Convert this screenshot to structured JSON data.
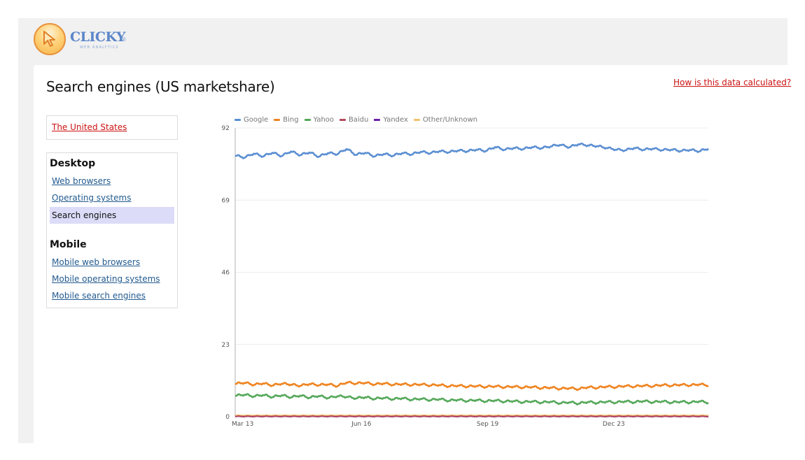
{
  "brand": {
    "name": "CLICKY",
    "registered_mark": "®",
    "tagline": "WEB ANALYTICS",
    "logo_icon": "cursor-arrow-icon"
  },
  "page": {
    "title": "Search engines (US marketshare)",
    "help_link": "How is this data calculated?"
  },
  "sidebar": {
    "country_link": "The United States",
    "sections": [
      {
        "heading": "Desktop",
        "items": [
          {
            "label": "Web browsers",
            "active": false
          },
          {
            "label": "Operating systems",
            "active": false
          },
          {
            "label": "Search engines",
            "active": true
          }
        ]
      },
      {
        "heading": "Mobile",
        "items": [
          {
            "label": "Mobile web browsers",
            "active": false
          },
          {
            "label": "Mobile operating systems",
            "active": false
          },
          {
            "label": "Mobile search engines",
            "active": false
          }
        ]
      }
    ]
  },
  "chart_data": {
    "type": "line",
    "title": "",
    "xlabel": "",
    "ylabel": "",
    "ylim": [
      0,
      92
    ],
    "yticks": [
      0,
      23,
      46,
      69,
      92
    ],
    "xtick_labels": [
      {
        "label": "Mar 13",
        "index": 0
      },
      {
        "label": "Jun 16",
        "index": 13.6
      },
      {
        "label": "Sep 19",
        "index": 27.2
      },
      {
        "label": "Dec 23",
        "index": 40.8
      }
    ],
    "grid": true,
    "legend_position": "top-left",
    "series": [
      {
        "name": "Google",
        "color": "#5b8fd2",
        "values": [
          83.2,
          82.5,
          83.8,
          82.9,
          84.1,
          83.0,
          84.5,
          83.3,
          84.2,
          82.8,
          84.0,
          83.6,
          85.3,
          83.4,
          84.1,
          82.9,
          83.7,
          83.1,
          84.0,
          83.5,
          84.4,
          83.9,
          84.6,
          84.2,
          84.8,
          84.5,
          85.1,
          84.6,
          85.9,
          85.0,
          85.6,
          85.2,
          85.9,
          85.5,
          86.1,
          86.6,
          85.8,
          86.8,
          86.4,
          86.2,
          85.6,
          85.1,
          84.8,
          85.6,
          85.0,
          85.4,
          84.9,
          85.1,
          84.6,
          85.0,
          84.5,
          85.4
        ]
      },
      {
        "name": "Bing",
        "color": "#ef8420",
        "values": [
          10.4,
          10.8,
          10.1,
          10.6,
          9.9,
          10.5,
          10.2,
          9.8,
          10.4,
          10.0,
          10.3,
          9.7,
          10.9,
          10.5,
          10.8,
          10.2,
          10.6,
          10.1,
          10.4,
          10.0,
          10.3,
          9.9,
          10.1,
          9.6,
          9.9,
          9.5,
          9.8,
          9.4,
          9.7,
          9.3,
          9.6,
          9.2,
          9.5,
          9.0,
          9.3,
          8.8,
          9.1,
          8.7,
          9.4,
          9.1,
          9.6,
          9.3,
          9.8,
          9.5,
          9.9,
          9.6,
          10.1,
          9.8,
          10.2,
          9.9,
          10.3,
          9.9
        ]
      },
      {
        "name": "Yahoo",
        "color": "#55a85a",
        "values": [
          6.6,
          7.0,
          6.4,
          6.9,
          6.2,
          6.8,
          6.1,
          6.7,
          6.0,
          6.6,
          5.9,
          6.5,
          6.3,
          5.8,
          6.2,
          5.6,
          6.0,
          5.5,
          5.9,
          5.3,
          5.7,
          5.2,
          5.6,
          5.0,
          5.4,
          4.9,
          5.3,
          4.8,
          5.2,
          4.7,
          5.0,
          4.5,
          4.9,
          4.4,
          4.8,
          4.2,
          4.6,
          4.1,
          4.7,
          4.3,
          4.8,
          4.4,
          4.9,
          4.5,
          5.0,
          4.5,
          4.9,
          4.4,
          4.8,
          4.4,
          4.9,
          4.4
        ]
      },
      {
        "name": "Baidu",
        "color": "#b5485a",
        "values": [
          0.1,
          0.1,
          0.1,
          0.1,
          0.1,
          0.1,
          0.1,
          0.1,
          0.1,
          0.1,
          0.1,
          0.1,
          0.1,
          0.1,
          0.1,
          0.1,
          0.1,
          0.1,
          0.1,
          0.1,
          0.1,
          0.1,
          0.1,
          0.1,
          0.1,
          0.1,
          0.1,
          0.1,
          0.1,
          0.1,
          0.1,
          0.1,
          0.1,
          0.1,
          0.1,
          0.1,
          0.1,
          0.1,
          0.1,
          0.1,
          0.1,
          0.1,
          0.1,
          0.1,
          0.1,
          0.1,
          0.1,
          0.1,
          0.1,
          0.1,
          0.1,
          0.1
        ]
      },
      {
        "name": "Yandex",
        "color": "#6a1fa8",
        "values": [
          0.05,
          0.05,
          0.05,
          0.05,
          0.05,
          0.05,
          0.05,
          0.05,
          0.05,
          0.05,
          0.05,
          0.05,
          0.05,
          0.05,
          0.05,
          0.05,
          0.05,
          0.05,
          0.05,
          0.05,
          0.05,
          0.05,
          0.05,
          0.05,
          0.05,
          0.05,
          0.05,
          0.05,
          0.05,
          0.05,
          0.05,
          0.05,
          0.05,
          0.05,
          0.05,
          0.05,
          0.05,
          0.05,
          0.05,
          0.05,
          0.05,
          0.05,
          0.05,
          0.05,
          0.05,
          0.05,
          0.05,
          0.05,
          0.05,
          0.05,
          0.05,
          0.05
        ]
      },
      {
        "name": "Other/Unknown",
        "color": "#f3c26d",
        "values": [
          0.4,
          0.4,
          0.4,
          0.4,
          0.4,
          0.4,
          0.4,
          0.4,
          0.4,
          0.4,
          0.4,
          0.4,
          0.4,
          0.4,
          0.4,
          0.4,
          0.4,
          0.4,
          0.4,
          0.4,
          0.4,
          0.4,
          0.4,
          0.4,
          0.4,
          0.4,
          0.4,
          0.4,
          0.4,
          0.4,
          0.4,
          0.4,
          0.4,
          0.4,
          0.4,
          0.4,
          0.4,
          0.4,
          0.4,
          0.4,
          0.4,
          0.4,
          0.4,
          0.4,
          0.4,
          0.4,
          0.4,
          0.4,
          0.4,
          0.4,
          0.4,
          0.4
        ]
      }
    ]
  }
}
